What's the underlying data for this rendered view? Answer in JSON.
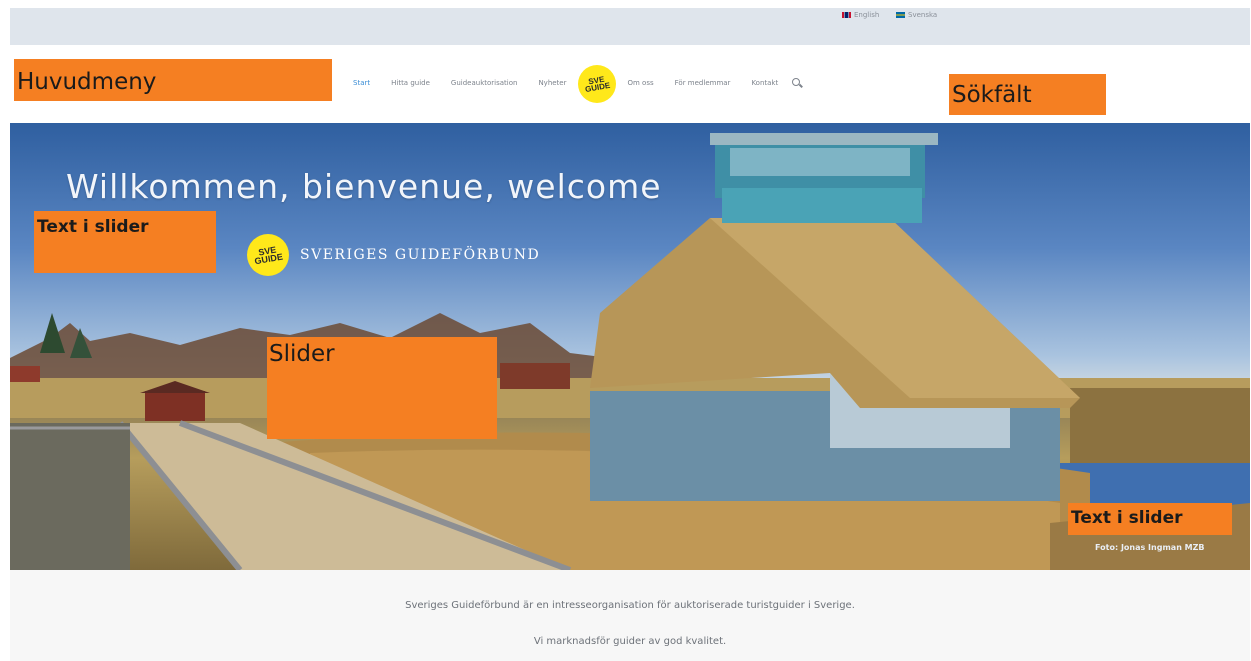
{
  "lang_bar": {
    "english": "English",
    "swedish": "Svenska"
  },
  "annotations": {
    "main_menu": "Huvudmeny",
    "search_field": "Sökfält",
    "slider_text_1": "Text i slider",
    "slider": "Slider",
    "slider_text_2": "Text i slider"
  },
  "nav": {
    "items": [
      {
        "label": "Start",
        "active": true
      },
      {
        "label": "Hitta guide",
        "active": false
      },
      {
        "label": "Guideauktorisation",
        "active": false
      },
      {
        "label": "Nyheter",
        "active": false
      }
    ],
    "logo_text": "SVE GUIDE",
    "items_after_logo": [
      {
        "label": "Om oss",
        "active": false
      },
      {
        "label": "För medlemmar",
        "active": false
      },
      {
        "label": "Kontakt",
        "active": false
      }
    ],
    "search_icon": "search-icon"
  },
  "hero": {
    "title": "Willkommen, bienvenue, welcome",
    "logo_text": "SVE GUIDE",
    "brand": "SVERIGES GUIDEFÖRBUND",
    "photo_credit": "Foto: Jonas Ingman MZB"
  },
  "intro": {
    "line1": "Sveriges Guideförbund är en intresseorganisation för auktoriserade turistguider i Sverige.",
    "line2": "Vi marknadsför guider av god kvalitet."
  },
  "colors": {
    "accent_orange": "#f57f22",
    "nav_active": "#3c8ed6",
    "logo_yellow": "#ffe81a"
  }
}
